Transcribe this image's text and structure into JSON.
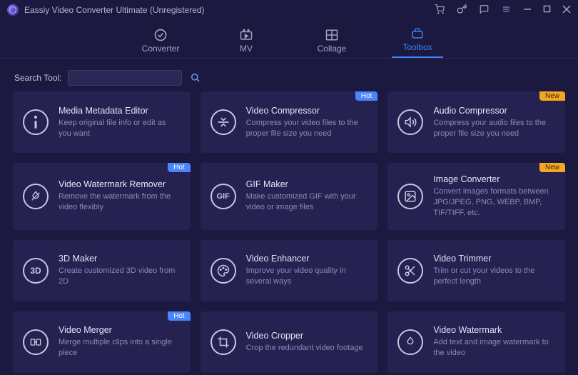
{
  "app": {
    "title": "Eassiy Video Converter Ultimate (Unregistered)"
  },
  "tabs": [
    {
      "label": "Converter"
    },
    {
      "label": "MV"
    },
    {
      "label": "Collage"
    },
    {
      "label": "Toolbox"
    }
  ],
  "search": {
    "label": "Search Tool:",
    "value": ""
  },
  "badges": {
    "hot": "Hot",
    "new": "New"
  },
  "tools": [
    {
      "title": "Media Metadata Editor",
      "desc": "Keep original file info or edit as you want",
      "icon": "info",
      "badge": null
    },
    {
      "title": "Video Compressor",
      "desc": "Compress your video files to the proper file size you need",
      "icon": "compress",
      "badge": "hot"
    },
    {
      "title": "Audio Compressor",
      "desc": "Compress your audio files to the proper file size you need",
      "icon": "audio",
      "badge": "new"
    },
    {
      "title": "Video Watermark Remover",
      "desc": "Remove the watermark from the video flexibly",
      "icon": "drop",
      "badge": "hot"
    },
    {
      "title": "GIF Maker",
      "desc": "Make customized GIF with your video or image files",
      "icon": "gif",
      "badge": null
    },
    {
      "title": "Image Converter",
      "desc": "Convert images formats between JPG/JPEG, PNG, WEBP, BMP, TIF/TIFF, etc.",
      "icon": "image",
      "badge": "new"
    },
    {
      "title": "3D Maker",
      "desc": "Create customized 3D video from 2D",
      "icon": "3d",
      "badge": null
    },
    {
      "title": "Video Enhancer",
      "desc": "Improve your video quality in several ways",
      "icon": "palette",
      "badge": null
    },
    {
      "title": "Video Trimmer",
      "desc": "Trim or cut your videos to the perfect length",
      "icon": "scissors",
      "badge": null
    },
    {
      "title": "Video Merger",
      "desc": "Merge multiple clips into a single piece",
      "icon": "merge",
      "badge": "hot"
    },
    {
      "title": "Video Cropper",
      "desc": "Crop the redundant video footage",
      "icon": "crop",
      "badge": null
    },
    {
      "title": "Video Watermark",
      "desc": "Add text and image watermark to the video",
      "icon": "watermark",
      "badge": null
    }
  ]
}
